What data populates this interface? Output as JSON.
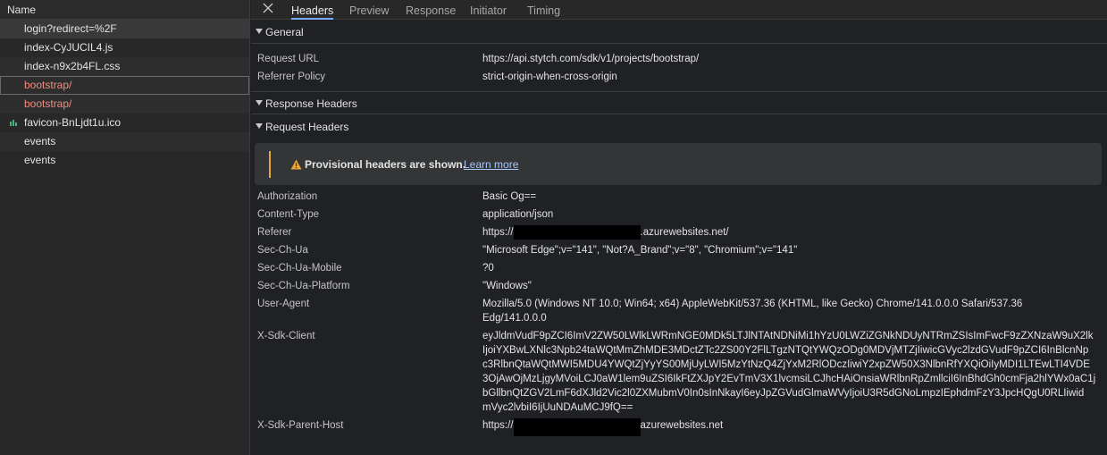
{
  "list": {
    "header": "Name",
    "items": [
      {
        "name": "login?redirect=%2F",
        "state": "selected"
      },
      {
        "name": "index-CyJUCIL4.js",
        "state": "normal"
      },
      {
        "name": "index-n9x2b4FL.css",
        "state": "normal"
      },
      {
        "name": "bootstrap/",
        "state": "error-focused"
      },
      {
        "name": "bootstrap/",
        "state": "error"
      },
      {
        "name": "favicon-BnLjdt1u.ico",
        "state": "normal"
      },
      {
        "name": "events",
        "state": "normal"
      },
      {
        "name": "events",
        "state": "normal"
      }
    ]
  },
  "tabs": [
    "Headers",
    "Preview",
    "Response",
    "Initiator",
    "Timing"
  ],
  "general": {
    "title": "General",
    "rows": [
      {
        "k": "Request URL",
        "v": "https://api.stytch.com/sdk/v1/projects/bootstrap/"
      },
      {
        "k": "Referrer Policy",
        "v": "strict-origin-when-cross-origin"
      }
    ]
  },
  "response_headers": {
    "title": "Response Headers"
  },
  "request_headers": {
    "title": "Request Headers",
    "warning": "Provisional headers are shown.",
    "learn_more": "Learn more",
    "authorization": {
      "k": "Authorization",
      "v": "Basic Og=="
    },
    "content_type": {
      "k": "Content-Type",
      "v": "application/json"
    },
    "referer": {
      "k": "Referer",
      "prefix": "https://",
      "suffix": ".azurewebsites.net/"
    },
    "sec_ch_ua": {
      "k": "Sec-Ch-Ua",
      "v": "\"Microsoft Edge\";v=\"141\", \"Not?A_Brand\";v=\"8\", \"Chromium\";v=\"141\""
    },
    "sec_ch_ua_mobile": {
      "k": "Sec-Ch-Ua-Mobile",
      "v": "?0"
    },
    "sec_ch_ua_platform": {
      "k": "Sec-Ch-Ua-Platform",
      "v": "\"Windows\""
    },
    "user_agent": {
      "k": "User-Agent",
      "v1": "Mozilla/5.0 (Windows NT 10.0; Win64; x64) AppleWebKit/537.36 (KHTML, like Gecko) Chrome/141.0.0.0 Safari/537.36",
      "v2": "Edg/141.0.0.0"
    },
    "x_sdk_client": {
      "k": "X-Sdk-Client",
      "lines": [
        "eyJldmVudF9pZCI6ImV2ZW50LWlkLWRmNGE0MDk5LTJlNTAtNDNiMi1hYzU0LWZiZGNkNDUyNTRmZSIsImFwcF9zZXNzaW9uX2lk",
        "IjoiYXBwLXNlc3Npb24taWQtMmZhMDE3MDctZTc2ZS00Y2FlLTgzNTQtYWQzODg0MDVjMTZjIiwicGVyc2lzdGVudF9pZCI6InBlcnNp",
        "c3RlbnQtaWQtMWI5MDU4YWQtZjYyYS00MjUyLWI5MzYtNzQ4ZjYxM2RlODczIiwiY2xpZW50X3NlbnRfYXQiOiIyMDI1LTEwLTI4VDE",
        "3OjAwOjMzLjgyMVoiLCJ0aW1lem9uZSI6IkFtZXJpY2EvTmV3X1lvcmsiLCJhcHAiOnsiaWRlbnRpZmllciI6InBhdGh0cmFja2hlYWx0aC1j",
        "bGllbnQtZGV2LmF6dXJld2Vic2l0ZXMubmV0In0sInNkayI6eyJpZGVudGlmaWVyIjoiU3R5dGNoLmpzIEphdmFzY3JpcHQgU0RLIiwid",
        "mVyc2lvbiI6IjUuNDAuMCJ9fQ=="
      ]
    },
    "x_sdk_parent_host": {
      "k": "X-Sdk-Parent-Host",
      "prefix": "https://",
      "suffix": "azurewebsites.net"
    }
  },
  "colors": {
    "accent": "#7cacf8",
    "error": "#f28b82",
    "warning": "#e7a53b",
    "link": "#a8c7fa"
  }
}
